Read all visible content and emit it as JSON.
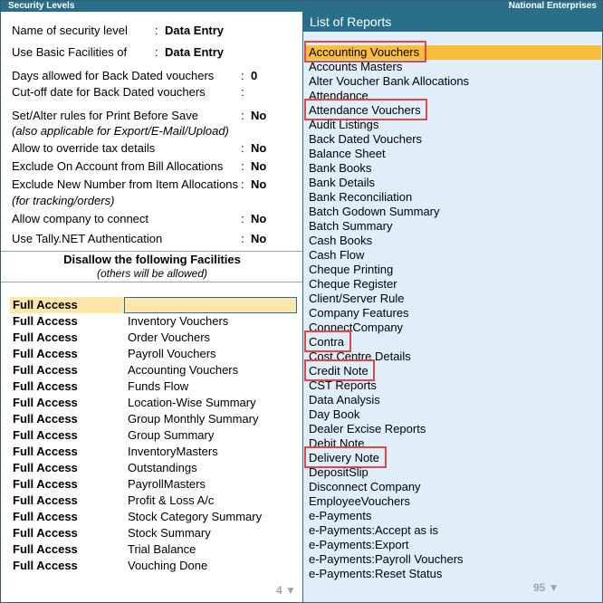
{
  "window": {
    "title": "Security Levels",
    "company": "National Enterprises"
  },
  "settings": {
    "name_label": "Name of security level",
    "name_value": "Data Entry",
    "basic_label": "Use Basic Facilities of",
    "basic_value": "Data Entry",
    "days_label": "Days allowed for Back Dated vouchers",
    "days_value": "0",
    "cutoff_label": "Cut-off date for Back Dated vouchers",
    "cutoff_value": "",
    "print_label": "Set/Alter rules for Print Before Save",
    "print_value": "No",
    "print_note": "(also applicable for Export/E-Mail/Upload)",
    "tax_label": "Allow to override tax details",
    "tax_value": "No",
    "onaccount_label": "Exclude On Account from Bill Allocations",
    "onaccount_value": "No",
    "newnumber_label": "Exclude New Number from Item Allocations",
    "newnumber_value": "No",
    "newnumber_note": "(for tracking/orders)",
    "connect_label": "Allow company to connect",
    "connect_value": "No",
    "tallynet_label": "Use Tally.NET Authentication",
    "tallynet_value": "No"
  },
  "disallow": {
    "heading": "Disallow the following Facilities",
    "subheading": "(others will be allowed)",
    "rows": [
      {
        "access": "Full Access",
        "facility": ""
      },
      {
        "access": "Full Access",
        "facility": "Inventory Vouchers"
      },
      {
        "access": "Full Access",
        "facility": "Order Vouchers"
      },
      {
        "access": "Full Access",
        "facility": "Payroll Vouchers"
      },
      {
        "access": "Full Access",
        "facility": "Accounting Vouchers"
      },
      {
        "access": "Full Access",
        "facility": "Funds Flow"
      },
      {
        "access": "Full Access",
        "facility": "Location-Wise Summary"
      },
      {
        "access": "Full Access",
        "facility": "Group Monthly Summary"
      },
      {
        "access": "Full Access",
        "facility": "Group Summary"
      },
      {
        "access": "Full Access",
        "facility": "InventoryMasters"
      },
      {
        "access": "Full Access",
        "facility": "Outstandings"
      },
      {
        "access": "Full Access",
        "facility": "PayrollMasters"
      },
      {
        "access": "Full Access",
        "facility": "Profit & Loss A/c"
      },
      {
        "access": "Full Access",
        "facility": "Stock Category Summary"
      },
      {
        "access": "Full Access",
        "facility": "Stock Summary"
      },
      {
        "access": "Full Access",
        "facility": "Trial Balance"
      },
      {
        "access": "Full Access",
        "facility": "Vouching Done"
      }
    ],
    "count": "4 ▼"
  },
  "reports": {
    "title": "List of Reports",
    "selected_index": 0,
    "items": [
      "Accounting Vouchers",
      "Accounts Masters",
      "Alter Voucher Bank Allocations",
      "Attendance",
      "Attendance Vouchers",
      "Audit Listings",
      "Back Dated Vouchers",
      "Balance Sheet",
      "Bank Books",
      "Bank Details",
      "Bank Reconciliation",
      "Batch Godown Summary",
      "Batch Summary",
      "Cash Books",
      "Cash Flow",
      "Cheque Printing",
      "Cheque Register",
      "Client/Server Rule",
      "Company Features",
      "ConnectCompany",
      "Contra",
      "Cost Centre Details",
      "Credit Note",
      "CST Reports",
      "Data Analysis",
      "Day Book",
      "Dealer Excise Reports",
      "Debit Note",
      "Delivery Note",
      "DepositSlip",
      "Disconnect Company",
      "EmployeeVouchers",
      "e-Payments",
      "e-Payments:Accept as is",
      "e-Payments:Export",
      "e-Payments:Payroll Vouchers",
      "e-Payments:Reset Status"
    ],
    "highlighted": [
      0,
      4,
      20,
      22,
      28
    ],
    "count": "95 ▼"
  },
  "colors": {
    "header": "#2a6f8a",
    "panel": "#e0eef9",
    "selection": "#fbbd3b",
    "markup": "#e04848",
    "focus_row": "#fde7aa"
  }
}
